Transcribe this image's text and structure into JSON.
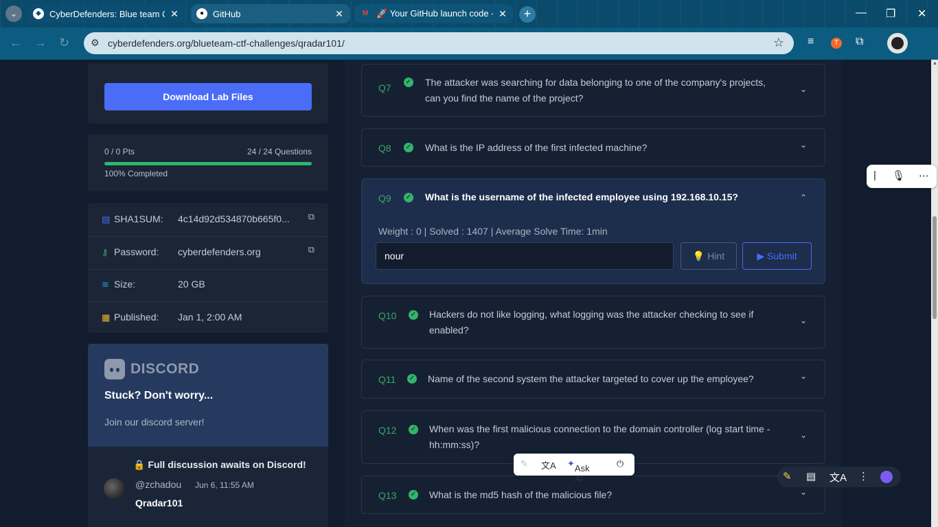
{
  "browser": {
    "tabs": [
      {
        "title": "CyberDefenders: Blue team CTF",
        "close": "✕"
      },
      {
        "title": "GitHub",
        "close": "✕"
      },
      {
        "title": "🚀 Your GitHub launch code - (",
        "close": "✕"
      }
    ],
    "new_tab": "+",
    "url": "cyberdefenders.org/blueteam-ctf-challenges/qradar101/"
  },
  "sidebar": {
    "download_label": "Download Lab Files",
    "points": "0 / 0 Pts",
    "questions": "24 / 24 Questions",
    "completed": "100% Completed",
    "progress_fraction": 1.0,
    "meta": [
      {
        "icon": "file-icon",
        "label": "SHA1SUM:",
        "value": "4c14d92d534870b665f0..."
      },
      {
        "icon": "key-icon",
        "label": "Password:",
        "value": "cyberdefenders.org"
      },
      {
        "icon": "database-icon",
        "label": "Size:",
        "value": "20 GB"
      },
      {
        "icon": "calendar-icon",
        "label": "Published:",
        "value": "Jan 1, 2:00 AM"
      }
    ],
    "discord": {
      "logo_text": "DISCORD",
      "stuck": "Stuck? Don't worry...",
      "join": "Join our discord server!",
      "full_discussion": "Full discussion awaits on Discord!",
      "user": "@zchadou",
      "date": "Jun 6, 11:55 AM",
      "message": "Qradar101"
    }
  },
  "questions": [
    {
      "num": "Q7",
      "text": "The attacker was searching for data belonging to one of the company's projects, can you find the name of the project?"
    },
    {
      "num": "Q8",
      "text": "What is the IP address of the first infected machine?"
    },
    {
      "num": "Q9",
      "text": "What is the username of the infected employee using 192.168.10.15?",
      "weight_line": "Weight : 0 | Solved : 1407 | Average Solve Time: 1min",
      "answer": "nour",
      "hint_label": "Hint",
      "submit_label": "Submit"
    },
    {
      "num": "Q10",
      "text": "Hackers do not like logging, what logging was the attacker checking to see if enabled?"
    },
    {
      "num": "Q11",
      "text": "Name of the second system the attacker targeted to cover up the employee?"
    },
    {
      "num": "Q12",
      "text": "When was the first malicious connection to the domain controller (log start time - hh:mm:ss)?"
    },
    {
      "num": "Q13",
      "text": "What is the md5 hash of the malicious file?"
    }
  ],
  "ai_bar": {
    "ask_ai": "Ask AI"
  },
  "colors": {
    "accent": "#4a6cf7",
    "success": "#34b36a",
    "card": "#1b2536"
  }
}
